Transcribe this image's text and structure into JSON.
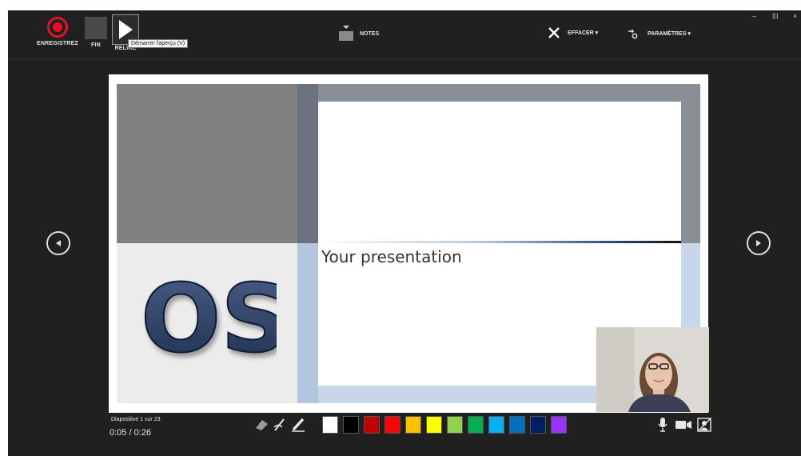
{
  "toolbar": {
    "record_label": "ENREGISTREZ",
    "stop_label": "FIN",
    "replay_label": "RELIRE",
    "replay_tooltip": "Démarrer l'aperçu (V)",
    "notes_label": "NOTES",
    "erase_label": "EFFACER ▾",
    "settings_label": "PARAMÈTRES ▾"
  },
  "window_controls": [
    "–",
    "⊡",
    "×"
  ],
  "slide": {
    "logo_text": "OS",
    "title": "Your presentation"
  },
  "status": {
    "slide_counter": "Diapositive 1 sur 23",
    "timer": "0:05 / 0:26"
  },
  "pen_tools": [
    "eraser-icon",
    "pen-icon",
    "highlighter-icon"
  ],
  "colors": [
    "#ffffff",
    "#000000",
    "#c00000",
    "#ff0000",
    "#ffc000",
    "#ffff00",
    "#92d050",
    "#00b050",
    "#00b0f0",
    "#0070c0",
    "#002060",
    "#9933ff"
  ],
  "accent": {
    "record": "#e81123"
  },
  "media_controls": [
    "microphone-icon",
    "camera-icon",
    "camera-preview-icon"
  ]
}
